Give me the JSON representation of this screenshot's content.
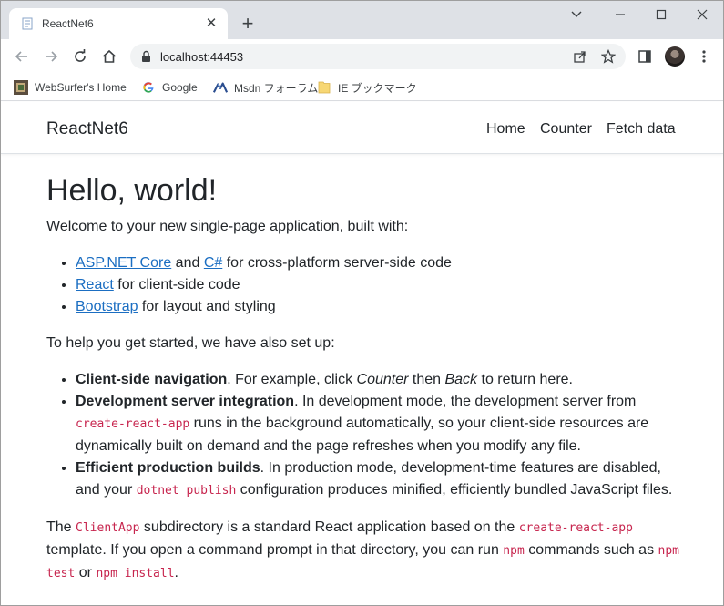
{
  "browser": {
    "tab_title": "ReactNet6",
    "url": "localhost:44453",
    "bookmarks": [
      {
        "label": "WebSurfer's Home"
      },
      {
        "label": "Google"
      },
      {
        "label": "Msdn フォーラム"
      },
      {
        "label": "IE ブックマーク"
      }
    ]
  },
  "navbar": {
    "brand": "ReactNet6",
    "links": [
      "Home",
      "Counter",
      "Fetch data"
    ]
  },
  "main": {
    "heading": "Hello, world!",
    "intro": "Welcome to your new single-page application, built with:",
    "built_with": {
      "item1": {
        "link1": "ASP.NET Core",
        "and": " and ",
        "link2": "C#",
        "rest": " for cross-platform server-side code"
      },
      "item2": {
        "link": "React",
        "rest": " for client-side code"
      },
      "item3": {
        "link": "Bootstrap",
        "rest": " for layout and styling"
      }
    },
    "setup_intro": "To help you get started, we have also set up:",
    "setup": {
      "item1": {
        "bold": "Client-side navigation",
        "t1": ". For example, click ",
        "em1": "Counter",
        "t2": " then ",
        "em2": "Back",
        "t3": " to return here."
      },
      "item2": {
        "bold": "Development server integration",
        "t1": ". In development mode, the development server from ",
        "code": "create-react-app",
        "t2": " runs in the background automatically, so your client-side resources are dynamically built on demand and the page refreshes when you modify any file."
      },
      "item3": {
        "bold": "Efficient production builds",
        "t1": ". In production mode, development-time features are disabled, and your ",
        "code": "dotnet publish",
        "t2": " configuration produces minified, efficiently bundled JavaScript files."
      }
    },
    "closing": {
      "t1": "The ",
      "code1": "ClientApp",
      "t2": " subdirectory is a standard React application based on the ",
      "code2": "create-react-app",
      "t3": " template. If you open a command prompt in that directory, you can run ",
      "code3": "npm",
      "t4": " commands such as ",
      "code4": "npm test",
      "t5": " or ",
      "code5": "npm install",
      "t6": "."
    }
  },
  "colors": {
    "link": "#1b6ec2",
    "code": "#c7254e",
    "tabstrip": "#dee1e6"
  },
  "icons": [
    "page-favicon-icon",
    "close-icon",
    "plus-icon",
    "chevron-down-icon",
    "minimize-icon",
    "maximize-icon",
    "window-close-icon",
    "back-arrow-icon",
    "forward-arrow-icon",
    "reload-icon",
    "home-icon",
    "lock-icon",
    "share-icon",
    "star-icon",
    "side-panel-icon",
    "more-vert-icon",
    "google-icon",
    "folder-icon"
  ]
}
